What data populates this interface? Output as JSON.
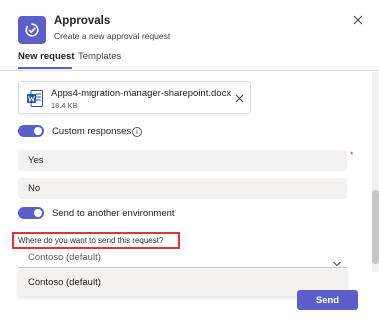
{
  "header": {
    "title": "Approvals",
    "subtitle": "Create a new approval request",
    "app_icon": "approvals-icon",
    "close_icon": "close-icon"
  },
  "tabs": [
    {
      "label": "New request",
      "active": true
    },
    {
      "label": "Templates",
      "active": false
    }
  ],
  "attachment": {
    "file_name": "Apps4-migration-manager-sharepoint.docx",
    "file_size": "18.4 KB",
    "file_icon": "word-document-icon",
    "remove_icon": "close-icon"
  },
  "custom_responses": {
    "label": "Custom responses",
    "enabled": true,
    "info_icon": "info-icon",
    "info_glyph": "i"
  },
  "responses": [
    "Yes",
    "No"
  ],
  "required_marker": "*",
  "send_to_environment": {
    "label": "Send to another environment",
    "enabled": true
  },
  "environment": {
    "question": "Where do you want to send this request?",
    "selected": "Contoso (default)",
    "options": [
      "Contoso (default)"
    ]
  },
  "footer": {
    "send_label": "Send"
  },
  "colors": {
    "accent": "#5b5fc7",
    "highlight_border": "#e0343a",
    "required": "#c4314b",
    "word_blue": "#2b579a"
  }
}
